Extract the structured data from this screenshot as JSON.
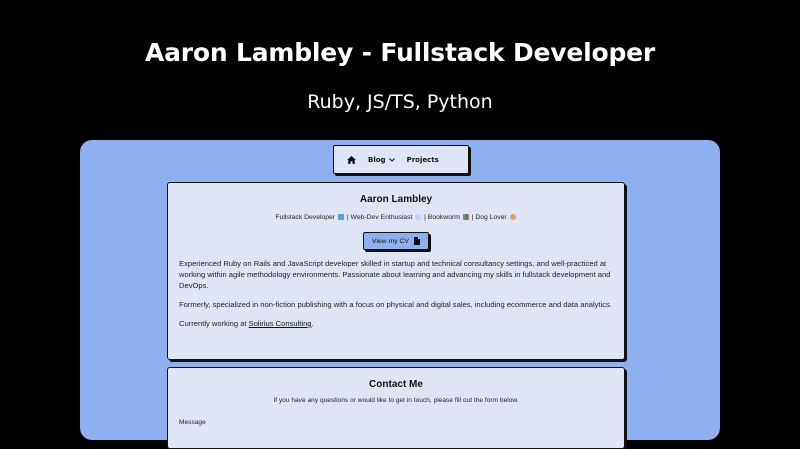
{
  "hero": {
    "title": "Aaron Lambley - Fullstack Developer",
    "subtitle": "Ruby, JS/TS, Python"
  },
  "nav": {
    "home_icon": "home-icon",
    "blog_label": "Blog",
    "blog_chevron": "chevron-down-icon",
    "projects_label": "Projects"
  },
  "about": {
    "name": "Aaron Lambley",
    "tag_1": "Fullstack Developer",
    "tag_2": "| Web-Dev Enthusiast",
    "tag_3": "| Bookworm",
    "tag_4": "| Dog Lover",
    "cv_button": "View my CV",
    "cv_icon": "document-icon",
    "para_1": "Experienced Ruby on Rails and JavaScript developer skilled in startup and technical consultancy settings, and well-practiced at working within agile methodology environments. Passionate about learning and advancing my skills in fullstack development and DevOps.",
    "para_2": "Formerly, specialized in non-fiction publishing with a focus on physical and digital sales, including ecommerce and data analytics.",
    "para_3_prefix": "Currently working at ",
    "para_3_link": "Solirius Consulting",
    "para_3_suffix": "."
  },
  "contact": {
    "title": "Contact Me",
    "subtitle": "If you have any questions or would like to get in touch, please fill out the form below.",
    "message_label": "Message"
  },
  "colors": {
    "background": "#000000",
    "panel": "#8fb0f0",
    "card": "#dfe5f5",
    "button": "#8fb0f0"
  }
}
